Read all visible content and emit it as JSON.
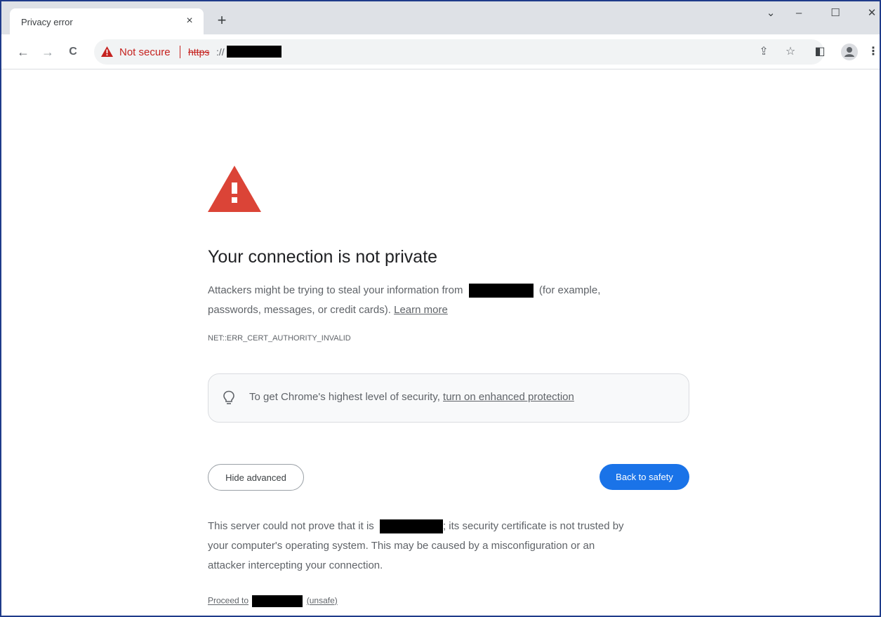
{
  "tab": {
    "title": "Privacy error",
    "close_glyph": "×",
    "new_tab_glyph": "+"
  },
  "window_controls": {
    "dropdown": "⌄",
    "minimize": "–",
    "maximize": "☐",
    "close": "✕"
  },
  "toolbar": {
    "back_glyph": "←",
    "forward_glyph": "→",
    "reload_glyph": "C",
    "security_label": "Not secure",
    "url_scheme": "https",
    "url_separator": "://",
    "share_glyph": "⇪",
    "star_glyph": "☆",
    "sidepanel_glyph": "◧",
    "menu_glyph": "⋮"
  },
  "page": {
    "heading": "Your connection is not private",
    "intro_before": "Attackers might be trying to steal your information from",
    "intro_after": "(for example,",
    "intro_line2": "passwords, messages, or credit cards).",
    "learn_more": "Learn more",
    "error_code": "NET::ERR_CERT_AUTHORITY_INVALID",
    "tip_text": "To get Chrome's highest level of security,",
    "tip_link": "turn on enhanced protection",
    "hide_advanced": "Hide advanced",
    "back_to_safety": "Back to safety",
    "detail_before": "This server could not prove that it is",
    "detail_after": "; its security certificate is not trusted by",
    "detail_line2": "your computer's operating system. This may be caused by a misconfiguration or an",
    "detail_line3": "attacker intercepting your connection.",
    "proceed_before": "Proceed to",
    "proceed_after": "(unsafe)"
  },
  "colors": {
    "warning_red": "#db4437",
    "not_secure_red": "#c5221f",
    "primary_blue": "#1a73e8",
    "tabstrip_gray": "#dee1e6"
  }
}
